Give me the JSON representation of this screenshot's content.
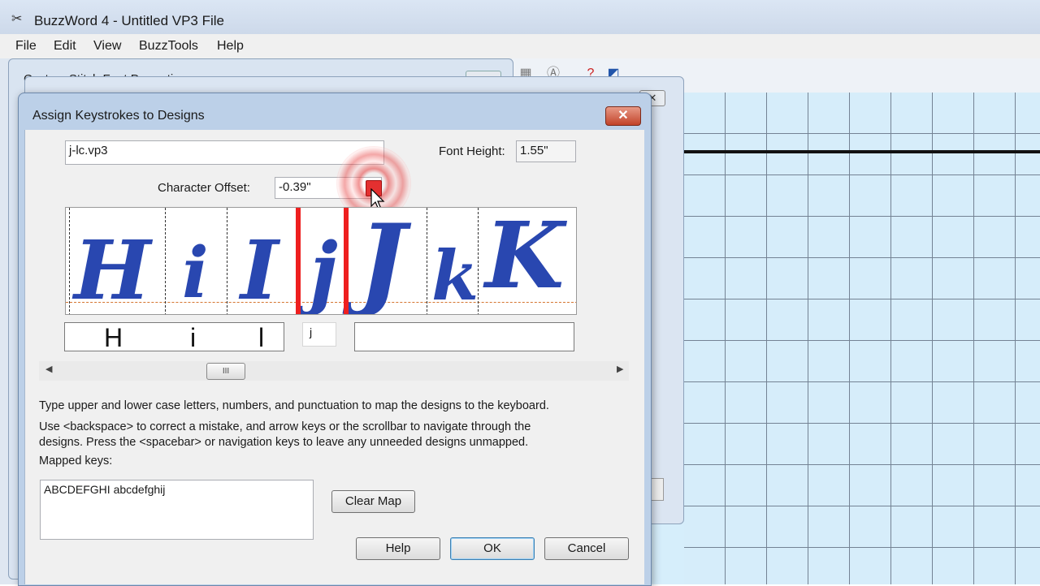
{
  "app": {
    "title": "BuzzWord 4 - Untitled VP3 File",
    "menu": [
      "File",
      "Edit",
      "View",
      "BuzzTools",
      "Help"
    ]
  },
  "background": {
    "dialog1_title": "Custom Stitch Font Properties",
    "dialog2_close": "✕"
  },
  "dialog": {
    "title": "Assign Keystrokes to Designs",
    "close": "✕",
    "filename": "j-lc.vp3",
    "font_height_label": "Font Height:",
    "font_height_value": "1.55\"",
    "char_offset_label": "Character Offset:",
    "char_offset_value": "-0.39\"",
    "glyphs": [
      "H",
      "i",
      "I",
      "j",
      "J",
      "k",
      "K"
    ],
    "mapped_boxes": {
      "left_chars": [
        "H",
        "i",
        "l"
      ],
      "current_char": "j",
      "right_chars": []
    },
    "scrollbar_thumb": "III",
    "instructions": [
      "Type upper and lower case letters, numbers, and punctuation to map the designs to the keyboard.",
      "Use <backspace> to correct a mistake, and arrow keys or the scrollbar to navigate through the",
      "designs.  Press the <spacebar> or navigation keys to leave any unneeded designs unmapped."
    ],
    "mapped_keys_label": "Mapped keys:",
    "mapped_keys_value": "ABCDEFGHI abcdefghij",
    "buttons": {
      "clear_map": "Clear Map",
      "help": "Help",
      "ok": "OK",
      "cancel": "Cancel"
    }
  },
  "colors": {
    "glyph": "#2947b0",
    "active_bar": "#ee1f1f",
    "grid_bg": "#d6eefb"
  }
}
